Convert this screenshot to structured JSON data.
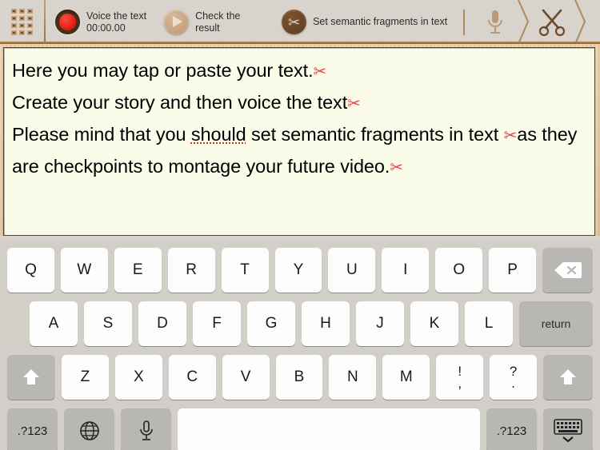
{
  "toolbar": {
    "grid_icon": "grid-icon",
    "actions": [
      {
        "icon": "record-icon",
        "label": "Voice the text",
        "time": "00:00.00"
      },
      {
        "icon": "play-icon",
        "label": "Check the result"
      },
      {
        "icon": "scissors-icon",
        "label": "Set semantic fragments in text"
      }
    ],
    "right_icons": [
      {
        "icon": "microphone-icon",
        "name": "voice-step"
      },
      {
        "icon": "scissors-icon",
        "name": "fragments-step"
      },
      {
        "icon": "stamp-icon",
        "name": "montage-step"
      }
    ]
  },
  "editor": {
    "name": "text-editor",
    "lines": [
      {
        "text": "Here you may tap or paste your text.",
        "mark": "✂"
      },
      {
        "text": "Create your story and then voice the text",
        "mark": "✂"
      },
      {
        "text_a": "Please mind that you ",
        "misspelled": "should",
        "text_b": " set semantic fragments in text "
      },
      {
        "mark": "✂",
        "text": "as they are checkpoints to montage your future video.",
        "mark_end": "✂"
      }
    ],
    "full_text": "Here you may tap or paste your text.✂ Create your story and then voice the text✂ Please mind that you should set semantic fragments in text ✂as they are checkpoints to montage your future video.✂",
    "background_color": "#fbfbe9",
    "mark_color": "#e8453c",
    "misspell_underline_color": "#d0342c"
  },
  "keyboard": {
    "row1": [
      "Q",
      "W",
      "E",
      "R",
      "T",
      "Y",
      "U",
      "I",
      "O",
      "P"
    ],
    "row1_special": {
      "label": "backspace-key",
      "icon": "backspace-icon"
    },
    "row2": [
      "A",
      "S",
      "D",
      "F",
      "G",
      "H",
      "J",
      "K",
      "L"
    ],
    "row2_special": {
      "label": "return"
    },
    "row3_shift_left": {
      "icon": "shift-icon"
    },
    "row3": [
      "Z",
      "X",
      "C",
      "V",
      "B",
      "N",
      "M"
    ],
    "row3_punct": [
      {
        "top": "!",
        "bottom": ","
      },
      {
        "top": "?",
        "bottom": "."
      }
    ],
    "row3_shift_right": {
      "icon": "shift-icon"
    },
    "row4": {
      "numbers_left": ".?123",
      "globe": "globe-icon",
      "mic": "microphone-icon",
      "space": "",
      "numbers_right": ".?123",
      "hide": "hide-keyboard-icon"
    },
    "key_color": "#fdfdfd",
    "modifier_color": "#b9b7b4",
    "background_color": "#d2cfc9"
  }
}
